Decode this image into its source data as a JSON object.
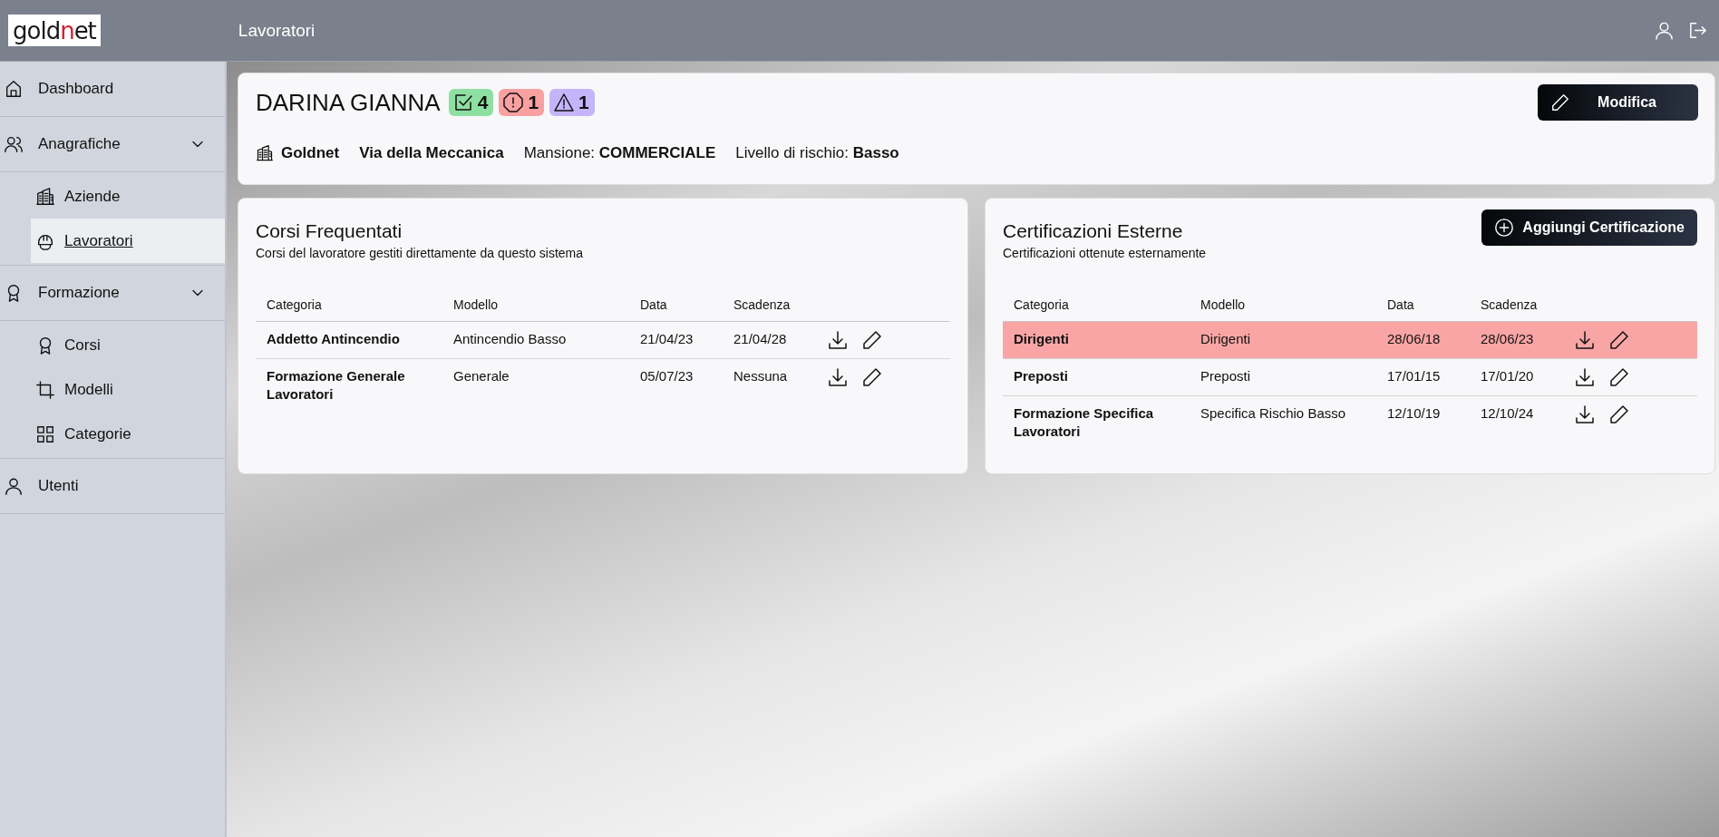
{
  "logo": {
    "before": "gold",
    "accent": "n",
    "after": "et"
  },
  "header": {
    "title": "Lavoratori"
  },
  "sidebar": {
    "items": [
      {
        "label": "Dashboard",
        "selected": false
      },
      {
        "label": "Anagrafiche",
        "selected": false,
        "expanded": true,
        "children": [
          {
            "label": "Aziende",
            "selected": false
          },
          {
            "label": "Lavoratori",
            "selected": true
          }
        ]
      },
      {
        "label": "Formazione",
        "selected": false,
        "expanded": true,
        "children": [
          {
            "label": "Corsi",
            "selected": false
          },
          {
            "label": "Modelli",
            "selected": false
          },
          {
            "label": "Categorie",
            "selected": false
          }
        ]
      },
      {
        "label": "Utenti",
        "selected": false
      }
    ]
  },
  "worker": {
    "name": "DARINA GIANNA",
    "badges": [
      {
        "kind": "valid",
        "count": "4"
      },
      {
        "kind": "expired",
        "count": "1"
      },
      {
        "kind": "warning",
        "count": "1"
      }
    ],
    "company": "Goldnet",
    "site": "Via della Meccanica",
    "role_label": "Mansione:",
    "role": "COMMERCIALE",
    "risk_label": "Livello di rischio:",
    "risk": "Basso",
    "edit_button": "Modifica"
  },
  "panels": [
    {
      "title": "Corsi Frequentati",
      "subtitle": "Corsi del lavoratore gestiti direttamente da questo sistema",
      "columns": [
        "Categoria",
        "Modello",
        "Data",
        "Scadenza"
      ],
      "rows": [
        {
          "cells": [
            "Addetto Antincendio",
            "Antincendio Basso",
            "21/04/23",
            "21/04/28"
          ],
          "expired": false
        },
        {
          "cells": [
            "Formazione Generale Lavoratori",
            "Generale",
            "05/07/23",
            "Nessuna"
          ],
          "expired": false
        }
      ]
    },
    {
      "title": "Certificazioni Esterne",
      "subtitle": "Certificazioni ottenute esternamente",
      "add_button": "Aggiungi Certificazione",
      "columns": [
        "Categoria",
        "Modello",
        "Data",
        "Scadenza"
      ],
      "rows": [
        {
          "cells": [
            "Dirigenti",
            "Dirigenti",
            "28/06/18",
            "28/06/23"
          ],
          "expired": true
        },
        {
          "cells": [
            "Preposti",
            "Preposti",
            "17/01/15",
            "17/01/20"
          ],
          "expired": false
        },
        {
          "cells": [
            "Formazione Specifica Lavoratori",
            "Specifica Rischio Basso",
            "12/10/19",
            "12/10/24"
          ],
          "expired": false
        }
      ]
    }
  ]
}
